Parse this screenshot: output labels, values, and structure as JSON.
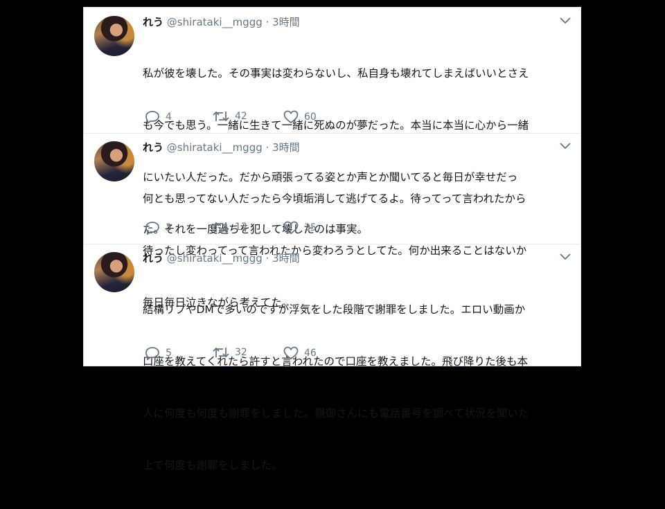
{
  "tweets": [
    {
      "name": "れう",
      "handle": "@shirataki__mggg",
      "dot": "·",
      "time": "3時間",
      "lines": [
        "私が彼を壊した。その事実は変わらないし、私自身も壊れてしまえばいいとさえ",
        "も今でも思う。一緒に生きて一緒に死ぬのが夢だった。本当に本当に心から一緒",
        "にいたい人だった。だから頑張ってる姿とか声とか聞いてると毎日が幸せだっ",
        "た。それを一度過ちを犯して壊したのは事実。"
      ],
      "replies": "4",
      "retweets": "42",
      "likes": "60"
    },
    {
      "name": "れう",
      "handle": "@shirataki__mggg",
      "dot": "·",
      "time": "3時間",
      "lines": [
        "何とも思ってない人だったら今頃垢消して逃げてるよ。待ってって言われたから",
        "待ったし変わってって言われたから変わろうとしてた。何か出来ることはないか",
        "毎日毎日泣きながら考えてた。"
      ],
      "replies": "3",
      "retweets": "13",
      "likes": "35"
    },
    {
      "name": "れう",
      "handle": "@shirataki__mggg",
      "dot": "·",
      "time": "3時間",
      "lines": [
        "結構リプやDMで多いのですが浮気をした段階で謝罪をしました。エロい動画か",
        "口座を教えてくれたら許すと言われたので口座を教えました。飛び降りた後も本",
        "人に何度も何度も謝罪をしました。親御さんにも電話番号を調べて状況を聞いた",
        "上で何度も謝罪をしました。"
      ],
      "replies": "5",
      "retweets": "32",
      "likes": "46"
    }
  ],
  "colors": {
    "accent": "#1da1f2",
    "muted": "#657786",
    "text": "#14171a",
    "background": "#000000"
  },
  "icons": [
    "reply-icon",
    "retweet-icon",
    "like-icon",
    "chevron-down-icon"
  ]
}
